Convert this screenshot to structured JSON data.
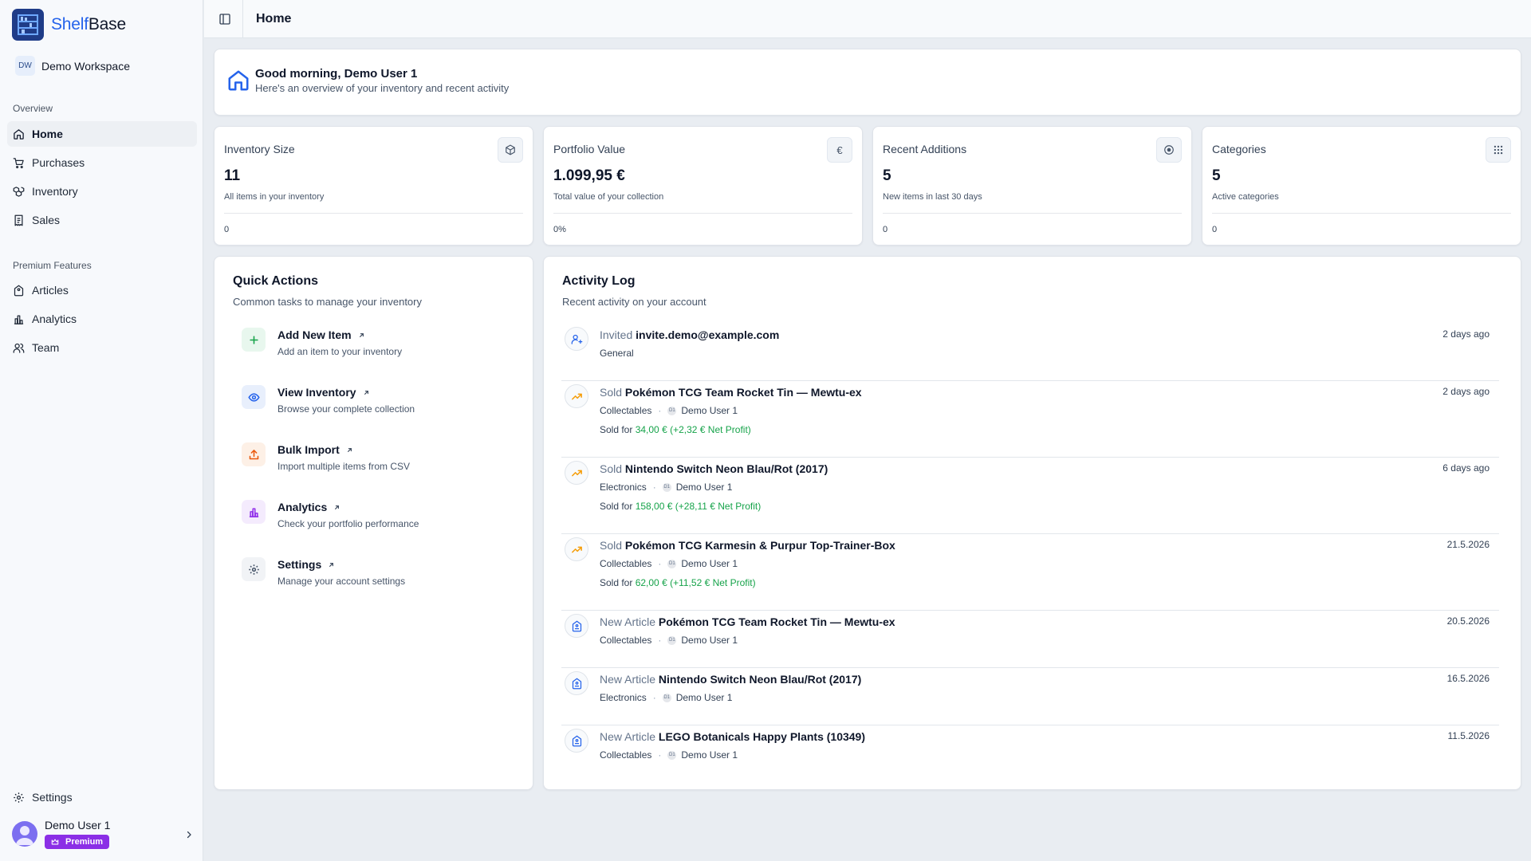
{
  "app": {
    "brand_part1": "Shelf",
    "brand_part2": "Base"
  },
  "workspace": {
    "badge": "DW",
    "name": "Demo Workspace"
  },
  "sidebar": {
    "overview_label": "Overview",
    "overview_items": [
      {
        "label": "Home",
        "icon": "home-icon",
        "active": true
      },
      {
        "label": "Purchases",
        "icon": "cart-icon"
      },
      {
        "label": "Inventory",
        "icon": "boxes-icon"
      },
      {
        "label": "Sales",
        "icon": "receipt-icon"
      }
    ],
    "premium_label": "Premium Features",
    "premium_items": [
      {
        "label": "Articles",
        "icon": "tag-icon"
      },
      {
        "label": "Analytics",
        "icon": "bar-chart-icon"
      },
      {
        "label": "Team",
        "icon": "users-icon"
      }
    ],
    "settings_label": "Settings",
    "user": {
      "name": "Demo User 1",
      "badge": "Premium"
    }
  },
  "topbar": {
    "title": "Home"
  },
  "welcome": {
    "title": "Good morning, Demo User 1",
    "subtitle": "Here's an overview of your inventory and recent activity"
  },
  "stats": [
    {
      "title": "Inventory Size",
      "value": "11",
      "desc": "All items in your inventory",
      "foot": "0",
      "icon": "package-icon"
    },
    {
      "title": "Portfolio Value",
      "value": "1.099,95 €",
      "desc": "Total value of your collection",
      "foot": "0%",
      "icon": "euro-icon",
      "icon_glyph": "€"
    },
    {
      "title": "Recent Additions",
      "value": "5",
      "desc": "New items in last 30 days",
      "foot": "0",
      "icon": "plus-circle-icon"
    },
    {
      "title": "Categories",
      "value": "5",
      "desc": "Active categories",
      "foot": "0",
      "icon": "grid-icon"
    }
  ],
  "quick_actions": {
    "title": "Quick Actions",
    "subtitle": "Common tasks to manage your inventory",
    "items": [
      {
        "title": "Add New Item",
        "desc": "Add an item to your inventory",
        "icon": "plus-icon",
        "color": "#16a34a",
        "bg": "#e8f7ee"
      },
      {
        "title": "View Inventory",
        "desc": "Browse your complete collection",
        "icon": "eye-icon",
        "color": "#2563eb",
        "bg": "#e8effc"
      },
      {
        "title": "Bulk Import",
        "desc": "Import multiple items from CSV",
        "icon": "upload-icon",
        "color": "#ea580c",
        "bg": "#fdf0e6"
      },
      {
        "title": "Analytics",
        "desc": "Check your portfolio performance",
        "icon": "bar-chart-icon",
        "color": "#9333ea",
        "bg": "#f4ebfd"
      },
      {
        "title": "Settings",
        "desc": "Manage your account settings",
        "icon": "gear-icon",
        "color": "#475569",
        "bg": "#f1f3f6"
      }
    ]
  },
  "activity": {
    "title": "Activity Log",
    "subtitle": "Recent activity on your account",
    "items": [
      {
        "verb": "Invited",
        "subject": "invite.demo@example.com",
        "category": "General",
        "time": "2 days ago",
        "icon": "user-plus-icon"
      },
      {
        "verb": "Sold",
        "subject": "Pokémon TCG Team Rocket Tin — Mewtu-ex",
        "category": "Collectables",
        "user_initials": "D1",
        "user": "Demo User 1",
        "sale_prefix": "Sold for",
        "price": "34,00 €",
        "profit": "(+2,32 € Net Profit)",
        "time": "2 days ago",
        "icon": "trending-up-icon"
      },
      {
        "verb": "Sold",
        "subject": "Nintendo Switch Neon Blau/Rot (2017)",
        "category": "Electronics",
        "user_initials": "D1",
        "user": "Demo User 1",
        "sale_prefix": "Sold for",
        "price": "158,00 €",
        "profit": "(+28,11 € Net Profit)",
        "time": "6 days ago",
        "icon": "trending-up-icon"
      },
      {
        "verb": "Sold",
        "subject": "Pokémon TCG Karmesin & Purpur Top-Trainer-Box",
        "category": "Collectables",
        "user_initials": "D1",
        "user": "Demo User 1",
        "sale_prefix": "Sold for",
        "price": "62,00 €",
        "profit": "(+11,52 € Net Profit)",
        "time": "21.5.2026",
        "icon": "trending-up-icon"
      },
      {
        "verb": "New Article",
        "subject": "Pokémon TCG Team Rocket Tin — Mewtu-ex",
        "category": "Collectables",
        "user_initials": "D1",
        "user": "Demo User 1",
        "time": "20.5.2026",
        "icon": "article-icon"
      },
      {
        "verb": "New Article",
        "subject": "Nintendo Switch Neon Blau/Rot (2017)",
        "category": "Electronics",
        "user_initials": "D1",
        "user": "Demo User 1",
        "time": "16.5.2026",
        "icon": "article-icon"
      },
      {
        "verb": "New Article",
        "subject": "LEGO Botanicals Happy Plants (10349)",
        "category": "Collectables",
        "user_initials": "D1",
        "user": "Demo User 1",
        "time": "11.5.2026",
        "icon": "article-icon"
      }
    ]
  },
  "colors": {
    "accent": "#2563eb",
    "brand_logo": "#1f3c88",
    "premium": "#8b2fe6",
    "profit": "#16a34a",
    "sold_icon": "#f59e0b"
  }
}
